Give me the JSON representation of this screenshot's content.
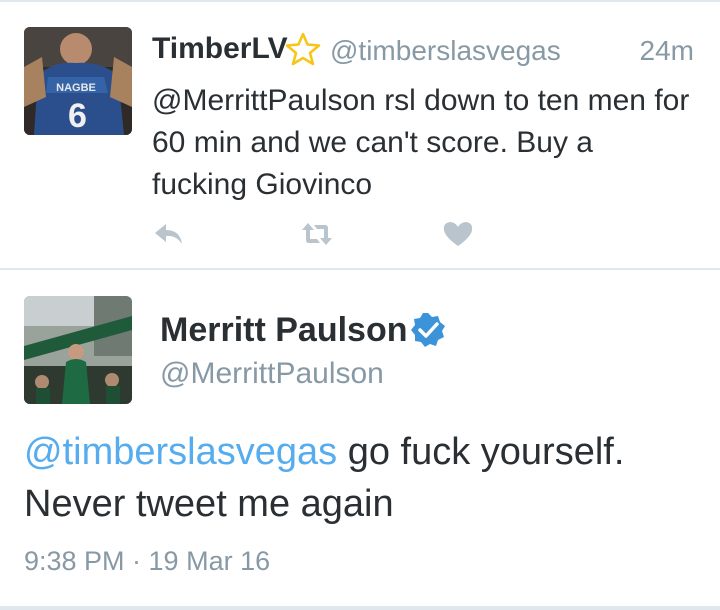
{
  "tweet1": {
    "display_name": "TimberLV",
    "handle": "@timberslasvegas",
    "time": "24m",
    "text": "@MerrittPaulson rsl down to ten men for 60 min and we can't score. Buy a fucking Giovinco",
    "avatar_jersey_name": "NAGBE",
    "avatar_jersey_number": "6",
    "actions": [
      "reply-icon",
      "retweet-icon",
      "like-icon"
    ],
    "colors": {
      "name": "#292f33",
      "meta": "#8899a6",
      "action": "#b9c4cc",
      "star": "#f5c518"
    }
  },
  "tweet2": {
    "display_name": "Merritt Paulson",
    "handle": "@MerrittPaulson",
    "verified": true,
    "text_mention": "@timberslasvegas",
    "text_body": " go fuck yourself. Never tweet me again",
    "timestamp": "9:38 PM · 19 Mar 16",
    "colors": {
      "mention": "#55acee",
      "verified": "#3b94d9"
    }
  }
}
